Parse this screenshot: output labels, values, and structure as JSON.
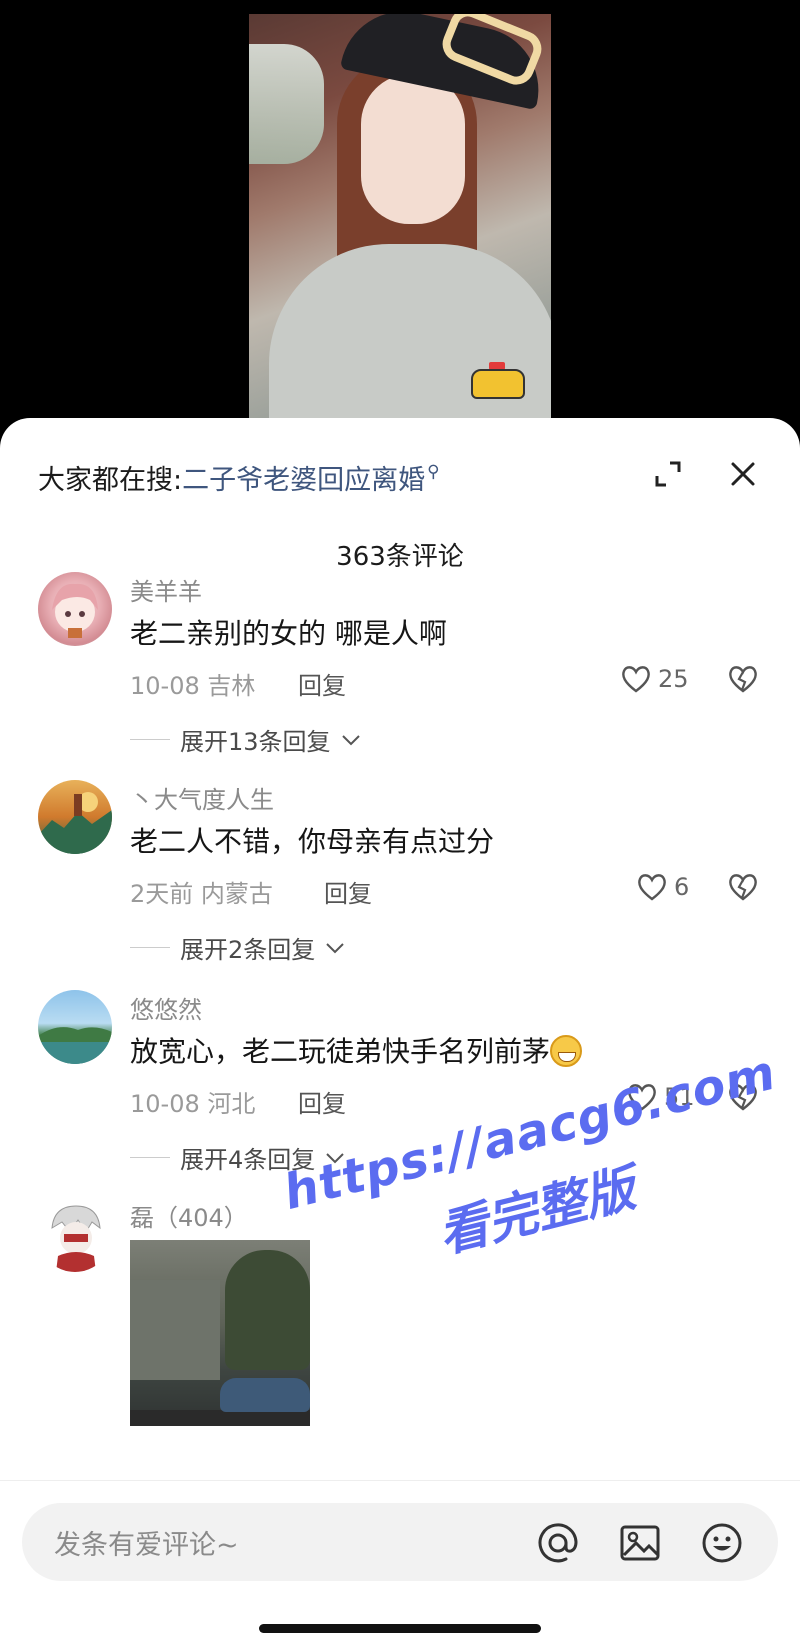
{
  "colors": {
    "link": "#3f567e",
    "watermark": "#5b6cf0",
    "sheet_bg": "#ffffff"
  },
  "search": {
    "prefix": "大家都在搜:",
    "query": "二子爷老婆回应离婚",
    "icon": "search-icon"
  },
  "header_icons": {
    "expand": "expand-icon",
    "close": "close-icon"
  },
  "comment_count": "363条评论",
  "comments": [
    {
      "username": "美羊羊",
      "content": "老二亲别的女的 哪是人啊",
      "date": "10-08 吉林",
      "reply": "回复",
      "likes": "25",
      "expand": "展开13条回复"
    },
    {
      "username": "丶大气度人生",
      "content": "老二人不错，你母亲有点过分",
      "date": "2天前 内蒙古",
      "reply": "回复",
      "likes": "6",
      "expand": "展开2条回复"
    },
    {
      "username": "悠悠然",
      "content": "放宽心，老二玩徒弟快手名列前茅",
      "date": "10-08 河北",
      "reply": "回复",
      "likes": "51",
      "expand": "展开4条回复"
    },
    {
      "username": "磊（404）"
    }
  ],
  "input": {
    "placeholder": "发条有爱评论~",
    "icons": [
      "at-icon",
      "image-icon",
      "smile-icon"
    ]
  },
  "watermark": {
    "line1": "https://aacg6.com",
    "line2": "看完整版"
  }
}
